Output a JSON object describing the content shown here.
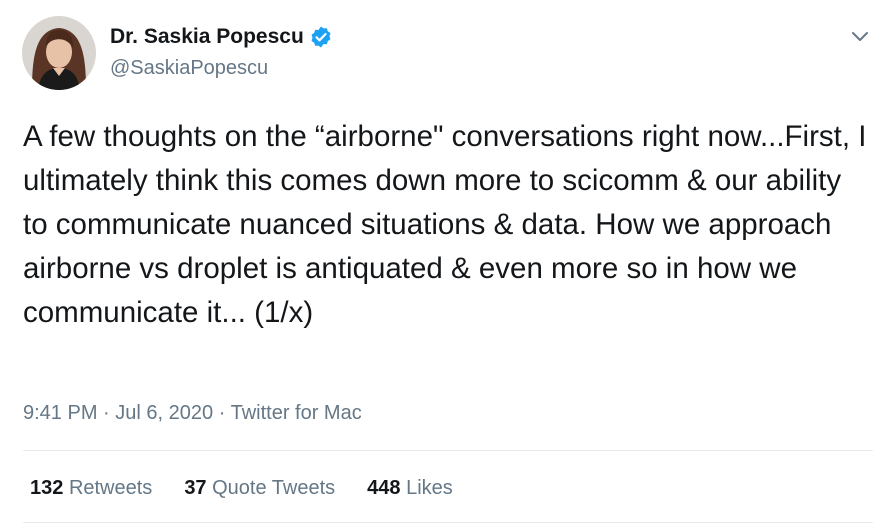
{
  "author": {
    "name": "Dr. Saskia Popescu",
    "handle": "@SaskiaPopescu",
    "verified": true,
    "avatar": "profile-photo"
  },
  "icons": {
    "verified": "verified-badge-icon",
    "menu": "chevron-down-icon"
  },
  "tweet": {
    "text": "A few thoughts on the “airborne\" conversations right now...First, I ultimately think this comes down more to scicomm & our ability to communicate nuanced situations & data. How we approach airborne vs droplet is antiquated & even more so in how we communicate it... (1/x)",
    "time": "9:41 PM",
    "separator": "·",
    "date": "Jul 6, 2020",
    "source": "Twitter for Mac"
  },
  "stats": {
    "retweets_count": "132",
    "retweets_label": "Retweets",
    "quotes_count": "37",
    "quotes_label": "Quote Tweets",
    "likes_count": "448",
    "likes_label": "Likes"
  },
  "colors": {
    "text": "#14171a",
    "secondary": "#657786",
    "verified": "#1da1f2",
    "divider": "#e6ecf0"
  }
}
